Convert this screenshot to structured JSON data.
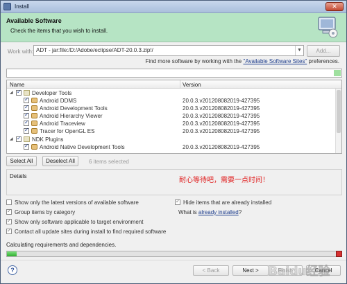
{
  "window": {
    "title": "Install"
  },
  "banner": {
    "heading": "Available Software",
    "description": "Check the items that you wish to install."
  },
  "work_with": {
    "label": "Work with:",
    "value": "ADT - jar:file:/D:/Adobe/eclipse/ADT-20.0.3.zip!/",
    "add_label": "Add..."
  },
  "find_more": {
    "prefix": "Find more software by working with the",
    "link": "\"Available Software Sites\"",
    "suffix": "preferences."
  },
  "tree": {
    "col_name": "Name",
    "col_version": "Version",
    "rows": [
      {
        "name": "Developer Tools",
        "version": ""
      },
      {
        "name": "Android DDMS",
        "version": "20.0.3.v201208082019-427395"
      },
      {
        "name": "Android Development Tools",
        "version": "20.0.3.v201208082019-427395"
      },
      {
        "name": "Android Hierarchy Viewer",
        "version": "20.0.3.v201208082019-427395"
      },
      {
        "name": "Android Traceview",
        "version": "20.0.3.v201208082019-427395"
      },
      {
        "name": "Tracer for OpenGL ES",
        "version": "20.0.3.v201208082019-427395"
      },
      {
        "name": "NDK Plugins",
        "version": ""
      },
      {
        "name": "Android Native Development Tools",
        "version": "20.0.3.v201208082019-427395"
      }
    ]
  },
  "buttons": {
    "select_all": "Select All",
    "deselect_all": "Deselect All",
    "selected_count": "6 items selected"
  },
  "details": {
    "label": "Details",
    "note": "耐心等待吧，需要一点时间！"
  },
  "options": {
    "latest_only": "Show only the latest versions of available software",
    "hide_installed": "Hide items that are already installed",
    "group_by_category": "Group items by category",
    "what_is_prefix": "What is",
    "what_is_link": "already installed",
    "what_is_suffix": "?",
    "applicable_only": "Show only software applicable to target environment",
    "contact_sites": "Contact all update sites during install to find required software"
  },
  "status": {
    "text": "Calculating requirements and dependencies.",
    "progress": 0.03
  },
  "nav": {
    "help": "?",
    "back": "< Back",
    "next": "Next >",
    "finish": "Finish",
    "cancel": "Cancel"
  },
  "watermark": {
    "text": "Baidu经验"
  }
}
